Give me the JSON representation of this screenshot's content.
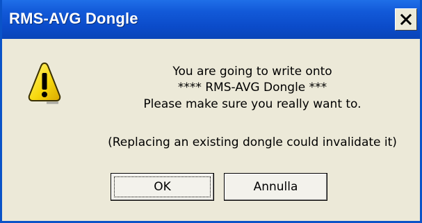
{
  "window": {
    "title": "RMS-AVG Dongle",
    "close_symbol": "×"
  },
  "icon": {
    "name": "warning-icon",
    "glyph": "!"
  },
  "message": {
    "line1": "You are going to write onto",
    "line2": "**** RMS-AVG Dongle ***",
    "line3": "Please make sure you really want to.",
    "line4": "(Replacing an existing dongle could invalidate it)"
  },
  "buttons": {
    "ok_label": "OK",
    "cancel_label": "Annulla"
  },
  "colors": {
    "titlebar": "#0b4bc9",
    "dialog_bg": "#ece9d8",
    "warning_yellow": "#f7d90f"
  }
}
